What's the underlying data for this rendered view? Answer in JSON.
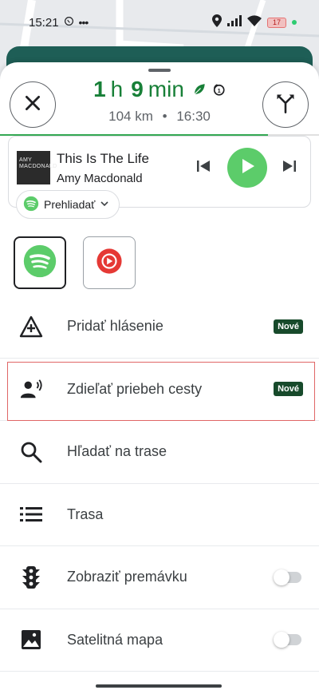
{
  "status_bar": {
    "time": "15:21",
    "battery": "17",
    "icons": [
      "whatsapp-icon",
      "more-dots-icon",
      "location-icon",
      "signal-icon",
      "wifi-icon",
      "battery-icon"
    ]
  },
  "trip": {
    "hours": "1",
    "hours_unit": "h",
    "minutes": "9",
    "minutes_unit": "min",
    "distance": "104 km",
    "separator": "•",
    "arrival": "16:30",
    "progress": 0.84,
    "accent_color": "#188038"
  },
  "media": {
    "album_art_text": "AMY MACDONALD",
    "title": "This Is The Life",
    "artist": "Amy Macdonald",
    "play_color": "#5ccc6a",
    "browse_label": "Prehliadať"
  },
  "apps": [
    {
      "name": "spotify",
      "selected": true
    },
    {
      "name": "youtube-music",
      "selected": false
    }
  ],
  "menu": {
    "items": [
      {
        "label": "Pridať hlásenie",
        "badge": "Nové"
      },
      {
        "label": "Zdieľať priebeh cesty",
        "badge": "Nové"
      },
      {
        "label": "Hľadať na trase"
      },
      {
        "label": "Trasa"
      },
      {
        "label": "Zobraziť premávku",
        "toggle": false
      },
      {
        "label": "Satelitná mapa",
        "toggle": false
      }
    ]
  }
}
